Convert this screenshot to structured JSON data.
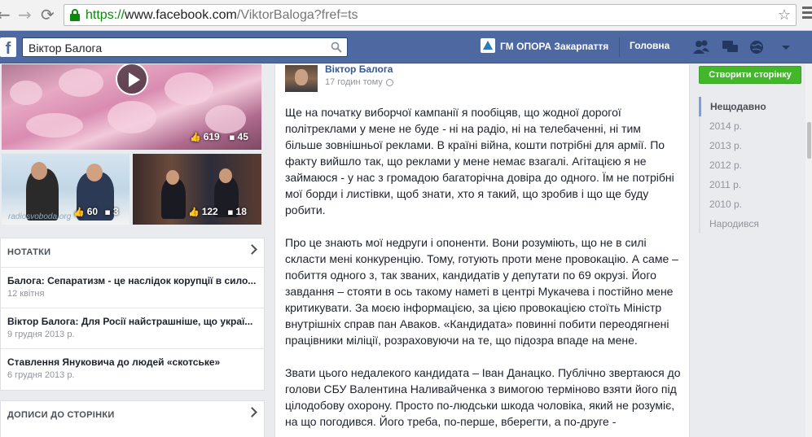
{
  "browser": {
    "url_scheme": "https://",
    "url_host": "www.facebook.com",
    "url_path": "/ViktorBaloga?fref=ts"
  },
  "fbbar": {
    "search_value": "Віктор Балога",
    "page_name": "ГМ ОПОРА Закарпаття",
    "home_label": "Головна"
  },
  "media": {
    "video_likes": "619",
    "video_comments": "45",
    "thumb1_likes": "60",
    "thumb1_comments": "3",
    "thumb1_watermark": "radiosvoboda.org",
    "thumb2_likes": "122",
    "thumb2_comments": "18"
  },
  "notes": {
    "header": "НОТАТКИ",
    "items": [
      {
        "title": "Балога: Сепаратизм - це наслідок корупції в сило...",
        "date": "12 квітня"
      },
      {
        "title": "Віктор Балога: Для Росії найстрашніше, що украї...",
        "date": "9 грудня 2013 р."
      },
      {
        "title": "Ставлення Януковича до людей «скотське»",
        "date": "6 грудня 2013 р."
      }
    ]
  },
  "posts_to_page": {
    "header": "ДОПИСИ ДО СТОРІНКИ"
  },
  "post": {
    "author": "Віктор Балога",
    "time": "17 годин тому",
    "paragraphs": [
      "Ще на початку виборчої кампанії я пообіцяв, що жодної дорогої політреклами у мене не буде - ні на радіо, ні на телебаченні, ні тим більше зовнішньої реклами. В країні війна, кошти потрібні для армії. По факту вийшло так, що реклами у мене немає взагалі. Агітацією я не займаюся - у нас з громадою багаторічна довіра до одного. Їм не потрібні мої борди і листівки, щоб знати, хто я такий, що зробив і що ще буду робити.",
      "Про це знають мої недруги і опоненти. Вони розуміють, що не в силі скласти мені конкуренцію. Тому, готують проти мене провокацію. А саме – побиття одного з, так званих, кандидатів у депутати по 69 окрузі. Його завдання – стояти в ось такому наметі в центрі Мукачева і постійно мене критикувати. За моєю інформацією, за цією провокацією стоїть Міністр внутрішніх справ пан Аваков. «Кандидата» повинні побити переодягнені працівники міліції, розраховуючи на те, що підозра впаде на мене.",
      "Звати цього недалекого кандидата – Іван Данацко. Публічно звертаюся до голови СБУ Валентина Наливайченка з вимогою терміново взяти його під цілодобову охорону. Просто по-людськи шкода чоловіка, який не розуміє, на що погодився. Його треба, по-перше, вберегти, а по-друге -"
    ]
  },
  "sidebar": {
    "create_button": "Створити сторінку",
    "years": [
      "Нещодавно",
      "2014 р.",
      "2013 р.",
      "2012 р.",
      "2011 р.",
      "2010 р.",
      "Народився"
    ]
  }
}
